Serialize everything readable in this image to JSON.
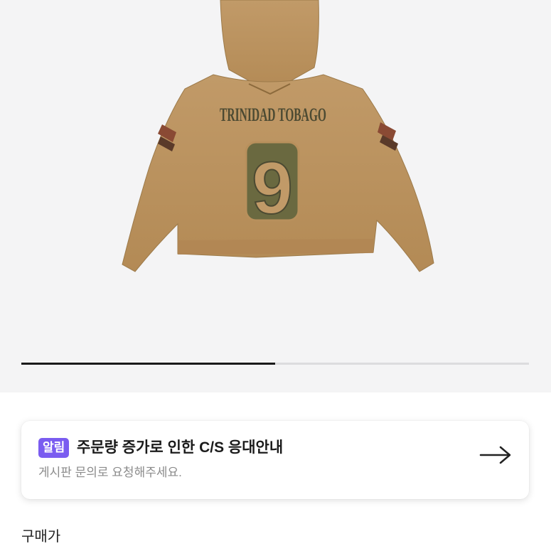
{
  "product": {
    "image_alt": "hoodie back view",
    "print_text": "TRINIDAD TOBAGO",
    "print_number": "9",
    "image_progress": 0.5
  },
  "notice": {
    "badge": "알림",
    "title": "주문량 증가로 인한 C/S 응대안내",
    "subtitle": "게시판 문의로 요청해주세요.",
    "icon": "arrow-right-icon",
    "badge_color": "#7a5cf0"
  },
  "price": {
    "label": "구매가"
  }
}
